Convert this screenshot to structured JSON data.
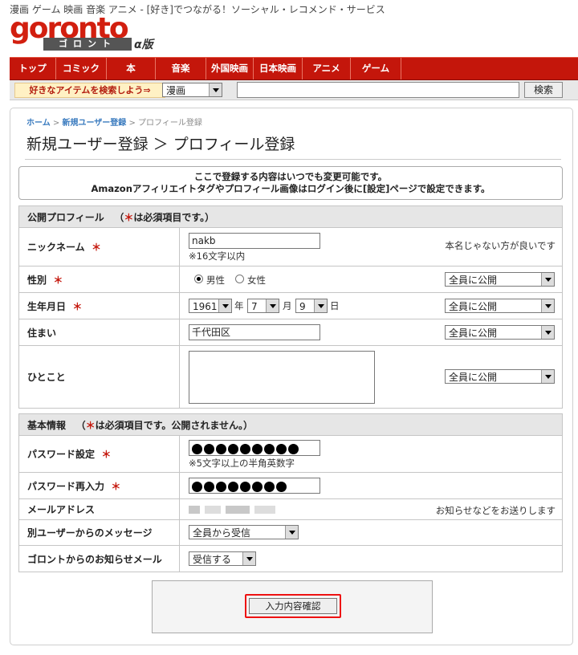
{
  "tagline": "漫画 ゲーム 映画 音楽 アニメ - [好き]でつながる！ソーシャル・レコメンド・サービス",
  "logo": {
    "main": "goronto",
    "sub": "ゴロント",
    "alpha": "α版"
  },
  "nav": [
    "トップ",
    "コミック",
    "本",
    "音楽",
    "外国映画",
    "日本映画",
    "アニメ",
    "ゲーム"
  ],
  "search": {
    "label": "好きなアイテムを検索しよう⇒",
    "category": "漫画",
    "button": "検索",
    "value": ""
  },
  "breadcrumb": {
    "home": "ホーム",
    "signup": "新規ユーザー登録",
    "current": "プロフィール登録",
    "sep": ">"
  },
  "page_title": "新規ユーザー登録 ＞ プロフィール登録",
  "notice": {
    "line1": "ここで登録する内容はいつでも変更可能です。",
    "line2": "Amazonアフィリエイトタグやプロフィール画像はログイン後に[設定]ページで設定できます。"
  },
  "public_section": {
    "title": "公開プロフィール",
    "req_note_pre": "（",
    "req_mark": "＊",
    "req_note": "は必須項目です。）"
  },
  "fields": {
    "nickname": {
      "label": "ニックネーム",
      "value": "nakb",
      "hint": "※16文字以内",
      "note": "本名じゃない方が良いです"
    },
    "gender": {
      "label": "性別",
      "male": "男性",
      "female": "女性",
      "visibility": "全員に公開"
    },
    "birthday": {
      "label": "生年月日",
      "year": "1961",
      "year_unit": "年",
      "month": "7",
      "month_unit": "月",
      "day": "9",
      "day_unit": "日",
      "visibility": "全員に公開"
    },
    "address": {
      "label": "住まい",
      "value": "千代田区",
      "visibility": "全員に公開"
    },
    "comment": {
      "label": "ひとこと",
      "value": "",
      "visibility": "全員に公開"
    }
  },
  "basic_section": {
    "title": "基本情報",
    "req_note_pre": "（",
    "req_mark": "＊",
    "req_note": "は必須項目です。公開されません。）"
  },
  "basic": {
    "password": {
      "label": "パスワード設定",
      "dots": 9,
      "hint": "※5文字以上の半角英数字"
    },
    "password2": {
      "label": "パスワード再入力",
      "dots": 8
    },
    "email": {
      "label": "メールアドレス",
      "note": "お知らせなどをお送りします"
    },
    "messages": {
      "label": "別ユーザーからのメッセージ",
      "value": "全員から受信"
    },
    "newsletter": {
      "label": "ゴロントからのお知らせメール",
      "value": "受信する"
    }
  },
  "req_mark": "＊",
  "submit_label": "入力内容確認",
  "colors": {
    "brand_red": "#c4160b",
    "link_blue": "#3a7bbf"
  }
}
